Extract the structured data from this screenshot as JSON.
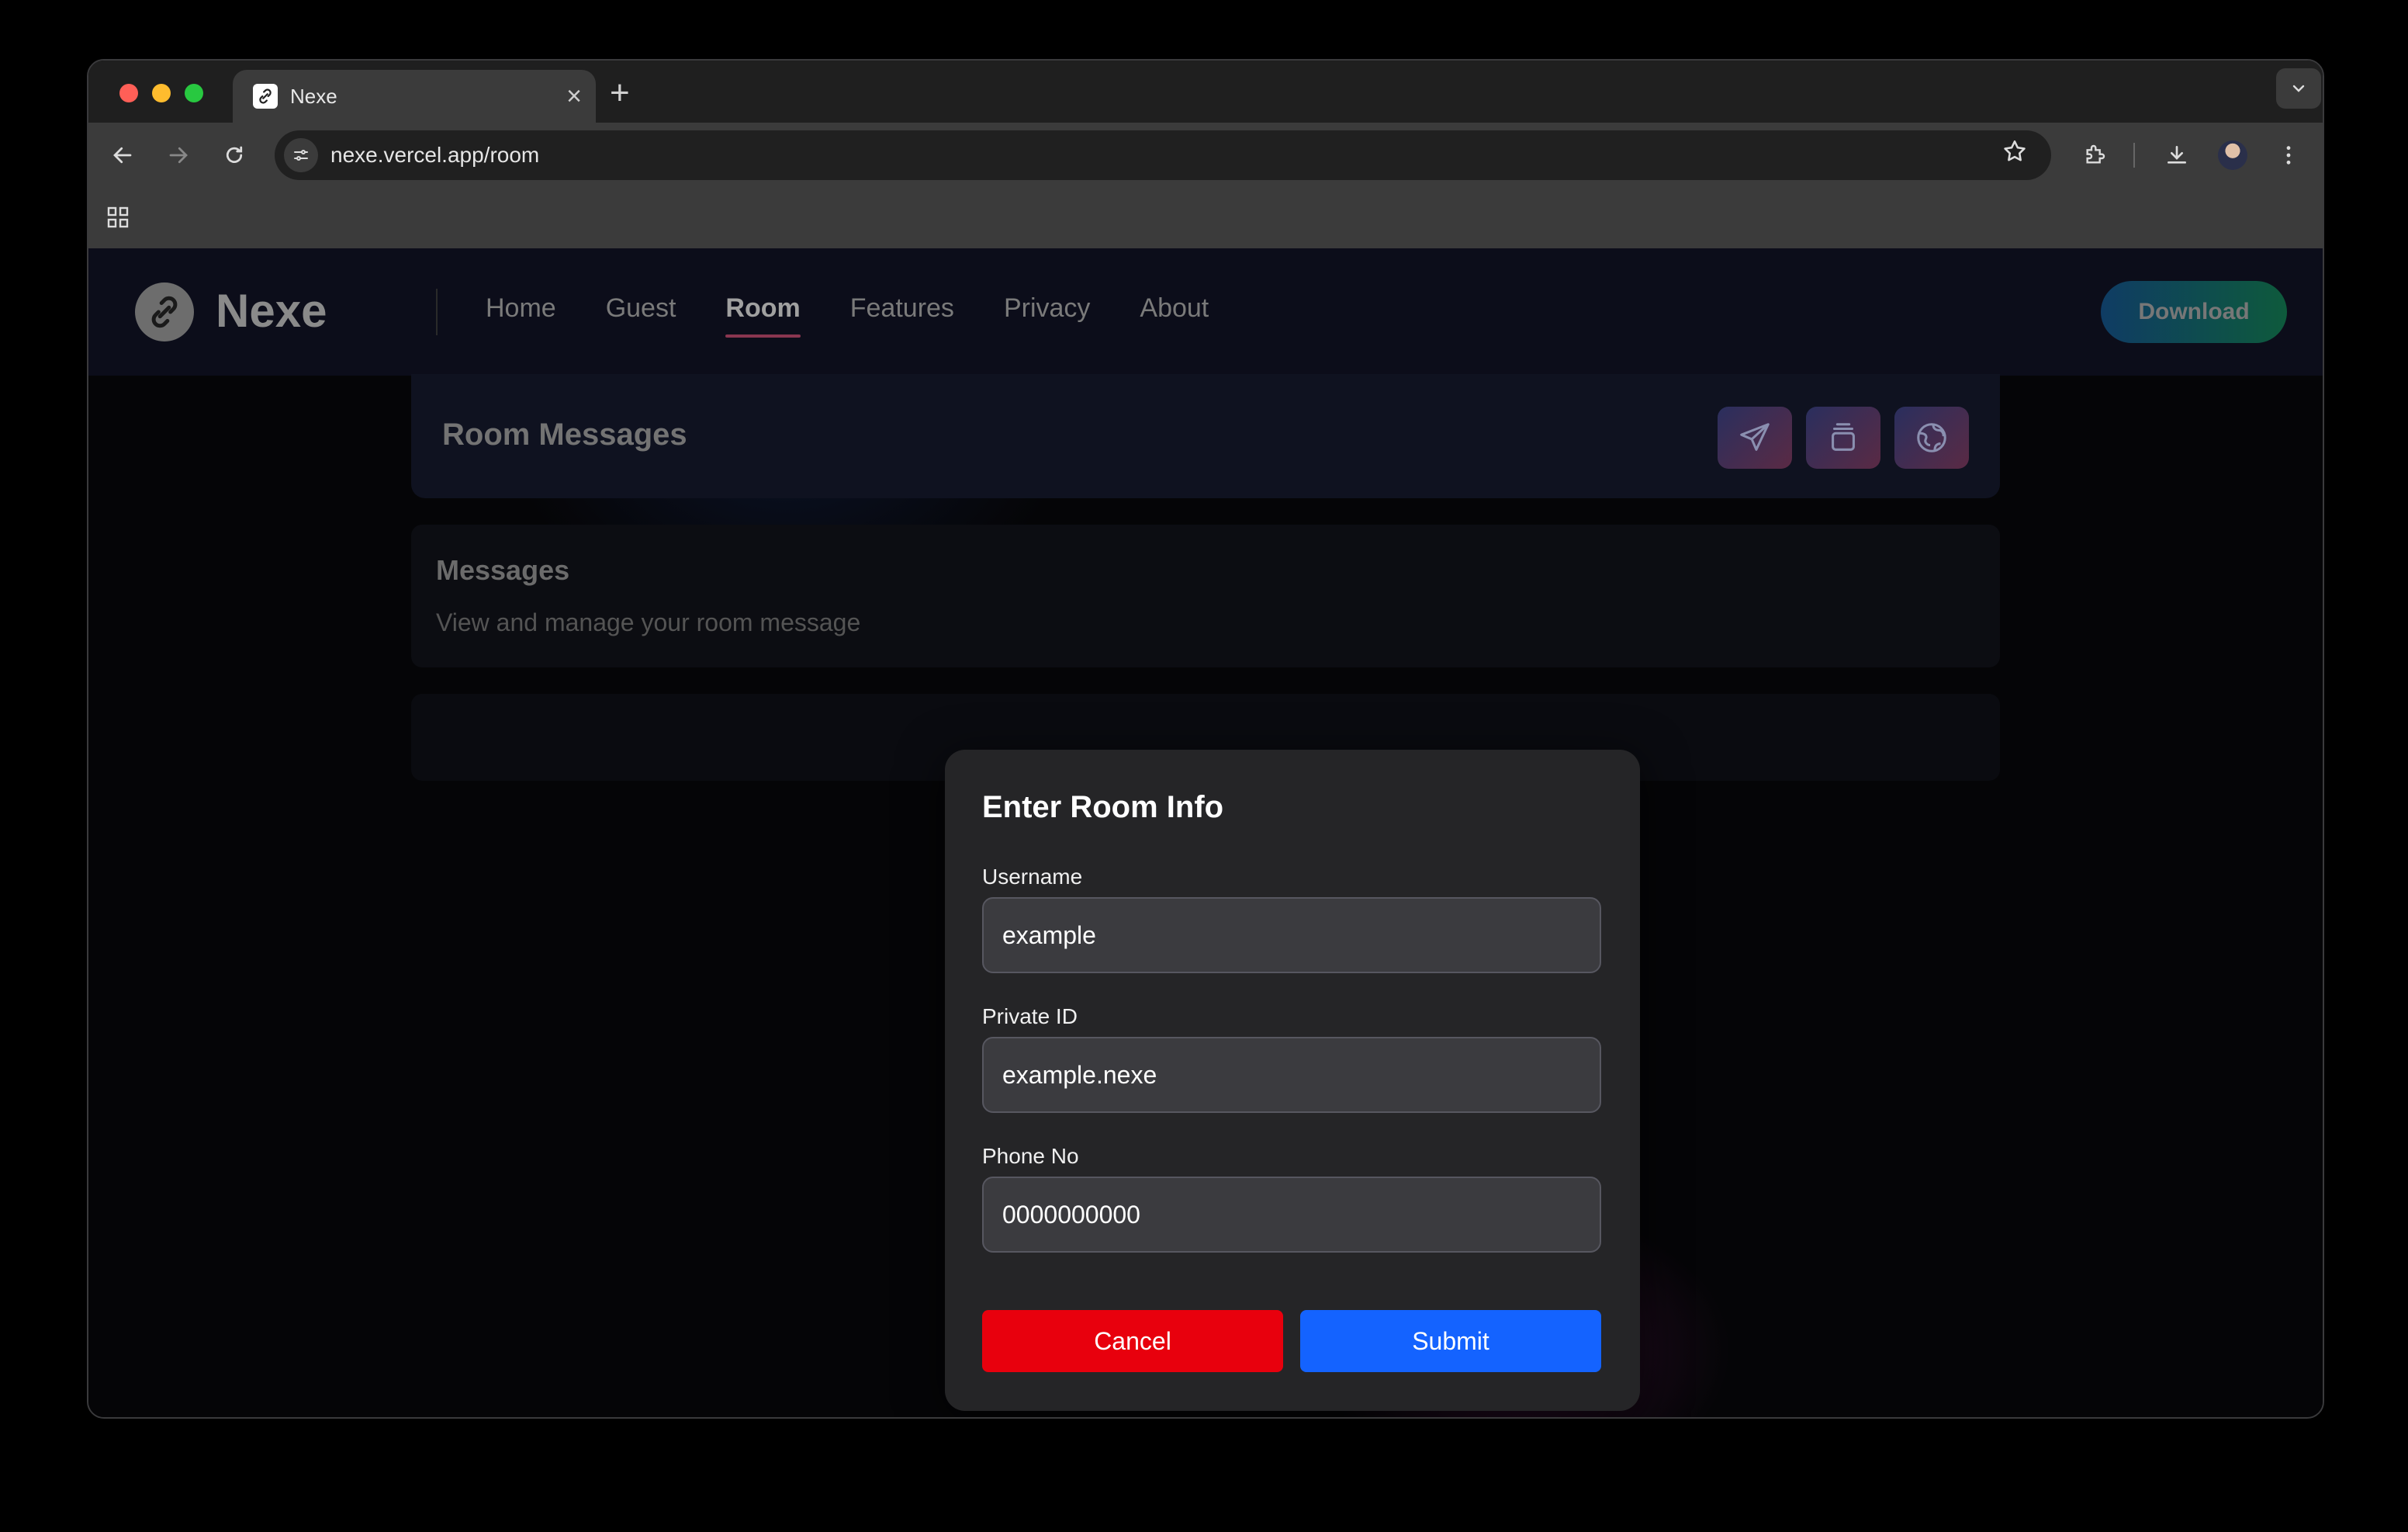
{
  "browser": {
    "tab_title": "Nexe",
    "url": "nexe.vercel.app/room",
    "traffic_lights": {
      "close": "#ff5f57",
      "minimize": "#febc2e",
      "maximize": "#28c840"
    }
  },
  "site": {
    "brand": "Nexe",
    "nav": [
      {
        "label": "Home",
        "active": false
      },
      {
        "label": "Guest",
        "active": false
      },
      {
        "label": "Room",
        "active": true
      },
      {
        "label": "Features",
        "active": false
      },
      {
        "label": "Privacy",
        "active": false
      },
      {
        "label": "About",
        "active": false
      }
    ],
    "download_label": "Download"
  },
  "room": {
    "title": "Room Messages",
    "actions": [
      "send-icon",
      "stack-icon",
      "globe-icon"
    ],
    "messages_title": "Messages",
    "messages_subtitle": "View and manage your room message"
  },
  "modal": {
    "title": "Enter Room Info",
    "username_label": "Username",
    "username_value": "example",
    "private_id_label": "Private ID",
    "private_id_value": "example.nexe",
    "phone_label": "Phone No",
    "phone_value": "0000000000",
    "cancel_label": "Cancel",
    "submit_label": "Submit"
  }
}
